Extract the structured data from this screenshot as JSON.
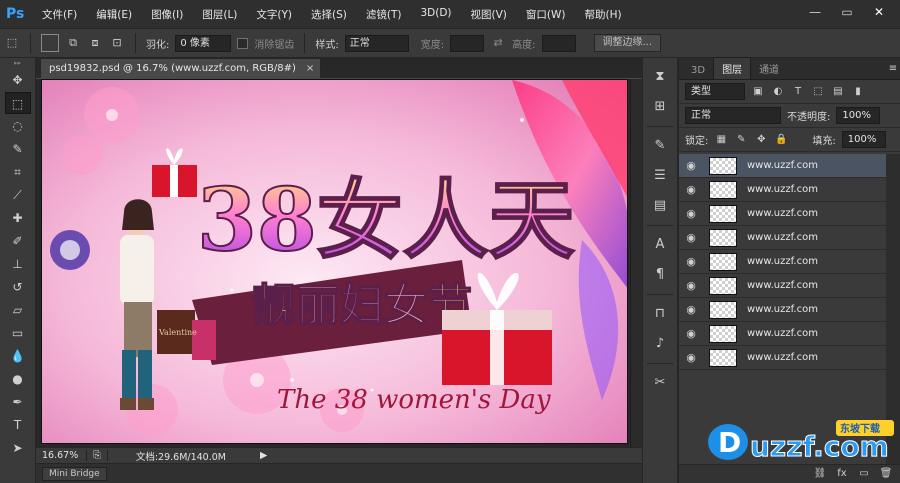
{
  "app": {
    "logo": "Ps"
  },
  "menu": [
    "文件(F)",
    "编辑(E)",
    "图像(I)",
    "图层(L)",
    "文字(Y)",
    "选择(S)",
    "滤镜(T)",
    "3D(D)",
    "视图(V)",
    "窗口(W)",
    "帮助(H)"
  ],
  "window_controls": {
    "minimize": "—",
    "restore": "▭",
    "close": "✕"
  },
  "options": {
    "feather_label": "羽化:",
    "feather_value": "0 像素",
    "antialias_label": "消除锯齿",
    "style_label": "样式:",
    "style_value": "正常",
    "width_label": "宽度:",
    "height_label": "高度:",
    "refine_button": "调整边缘..."
  },
  "document": {
    "tab_title": "psd19832.psd @ 16.7% (www.uzzf.com, RGB/8#)",
    "tab_close": "×",
    "zoom": "16.67%",
    "doc_info": "文档:29.6M/140.0M",
    "bottom_tab": "Mini Bridge"
  },
  "artwork": {
    "title_line1": "38女人天",
    "title_line2": "靓丽妇女节",
    "subtitle": "The 38 women's Day",
    "bag_tag": "Valentine"
  },
  "layers_panel": {
    "tabs": [
      "3D",
      "图层",
      "通道"
    ],
    "active_tab": "图层",
    "filter_kind": "类型",
    "blend_mode": "正常",
    "opacity_label": "不透明度:",
    "opacity_value": "100%",
    "lock_label": "锁定:",
    "fill_label": "填充:",
    "fill_value": "100%",
    "layers": [
      {
        "name": "www.uzzf.com",
        "selected": true
      },
      {
        "name": "www.uzzf.com",
        "selected": false
      },
      {
        "name": "www.uzzf.com",
        "selected": false
      },
      {
        "name": "www.uzzf.com",
        "selected": false
      },
      {
        "name": "www.uzzf.com",
        "selected": false
      },
      {
        "name": "www.uzzf.com",
        "selected": false
      },
      {
        "name": "www.uzzf.com",
        "selected": false
      },
      {
        "name": "www.uzzf.com",
        "selected": false
      },
      {
        "name": "www.uzzf.com",
        "selected": false
      }
    ]
  },
  "watermark": {
    "brand": "uzzf.com",
    "tag": "东坡下载"
  },
  "colors": {
    "accent": "#33a4ff",
    "panel_bg": "#3a3a3a",
    "selected_layer": "#4b5462"
  }
}
